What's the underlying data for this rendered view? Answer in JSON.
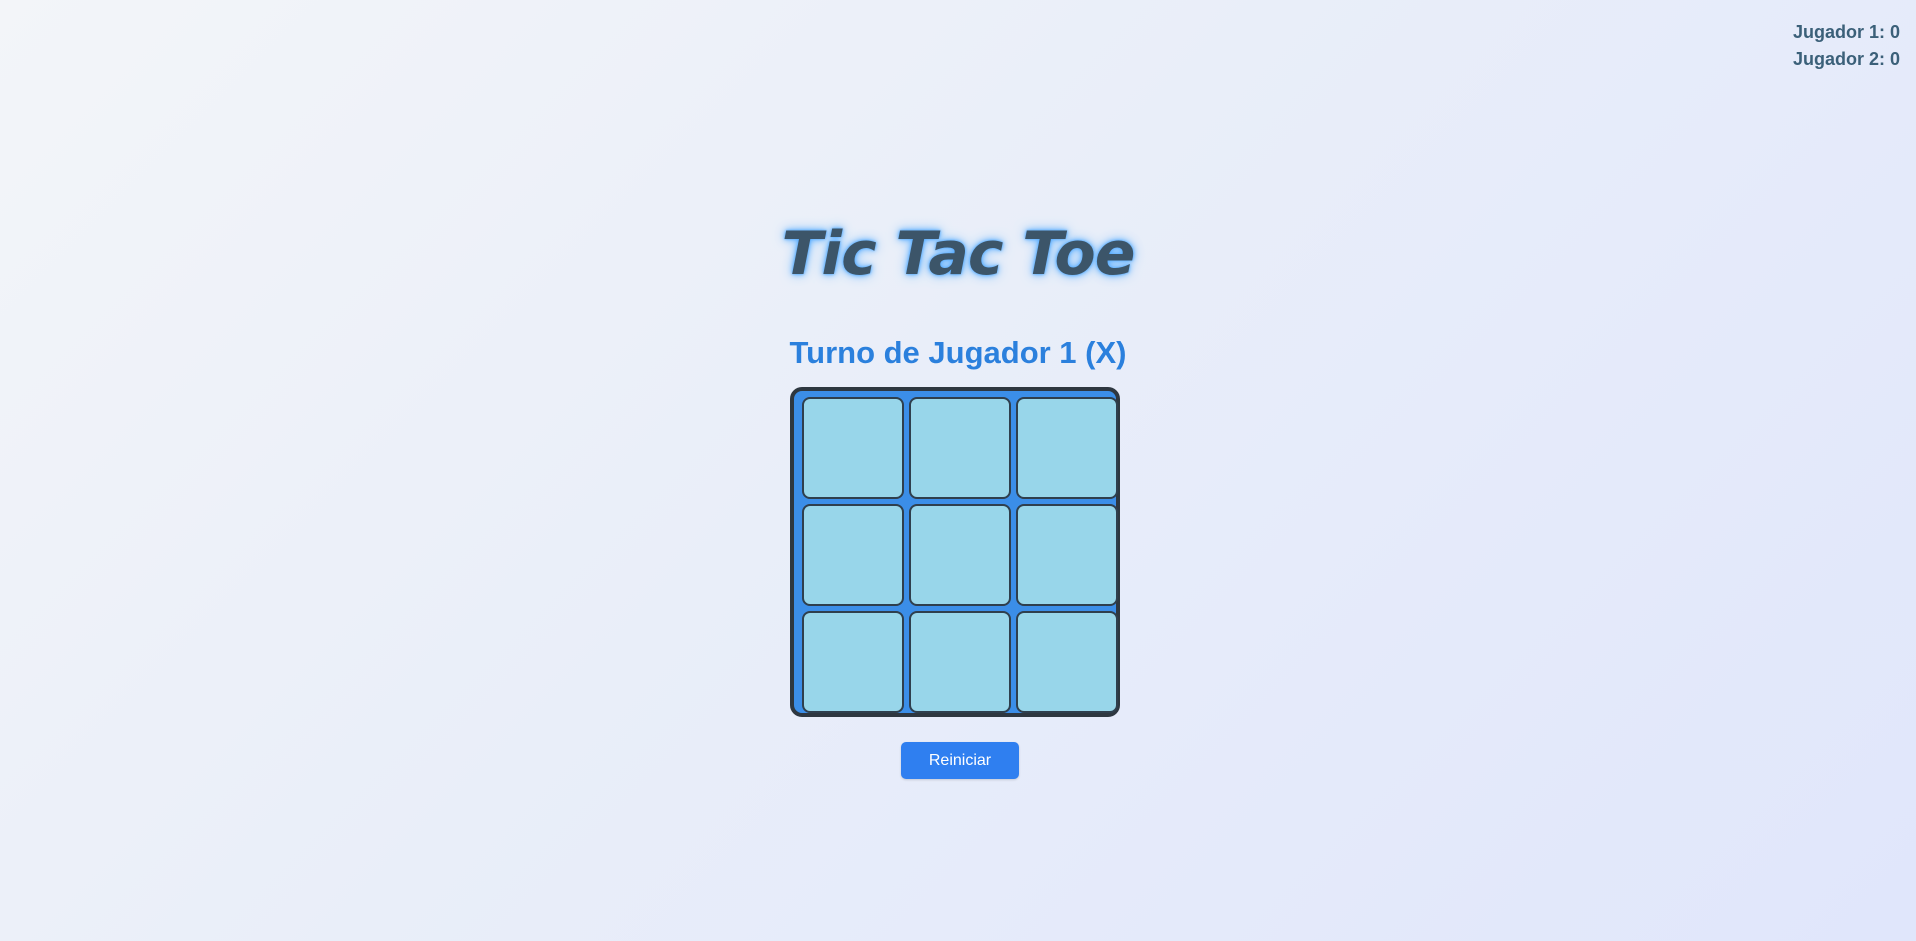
{
  "scoreboard": {
    "player1": "Jugador 1: 0",
    "player2": "Jugador 2: 0"
  },
  "game": {
    "title": "Tic Tac Toe",
    "turn_text": "Turno de Jugador 1 (X)",
    "board": [
      [
        "",
        "",
        ""
      ],
      [
        "",
        "",
        ""
      ],
      [
        "",
        "",
        ""
      ]
    ]
  },
  "controls": {
    "reset_label": "Reiniciar"
  },
  "colors": {
    "accent": "#2f7ff0",
    "board_frame": "#3b8ee8",
    "cell_fill": "#98d6ea",
    "title_text": "#3c5569",
    "turn_text": "#2b80dd",
    "score_text": "#3b6079"
  }
}
